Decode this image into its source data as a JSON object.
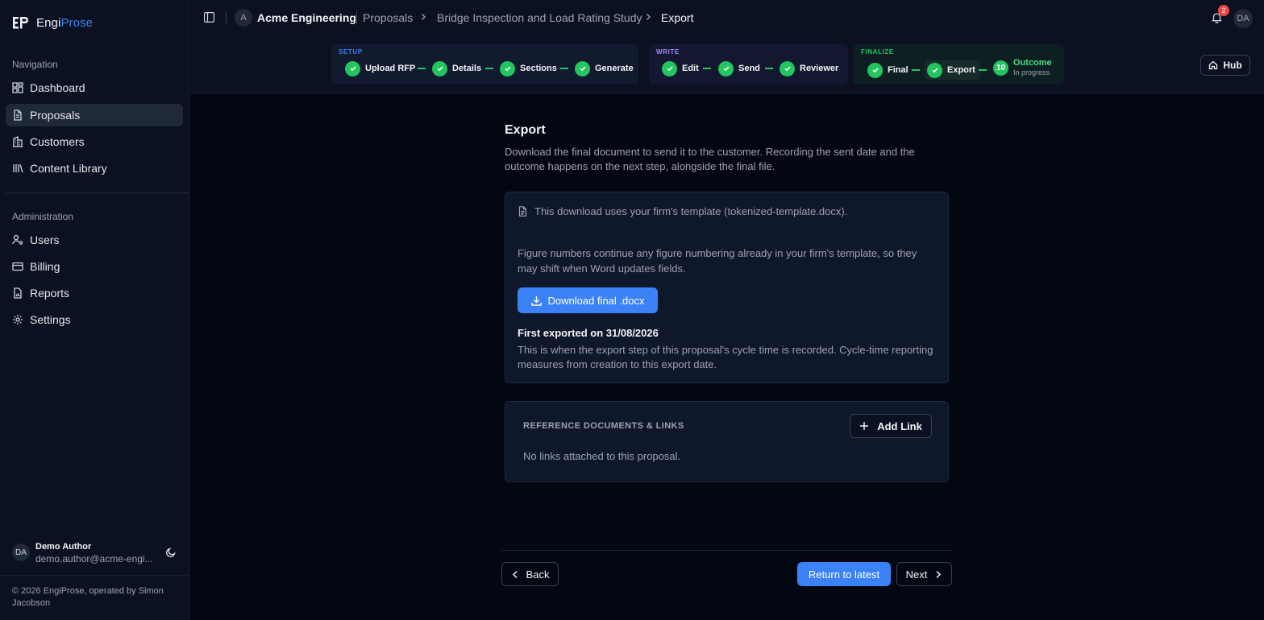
{
  "app": {
    "brand_prefix": "Engi",
    "brand_suffix": "Prose",
    "accent_color": "#3b82f6",
    "success_color": "#22c55e"
  },
  "sidebar": {
    "nav_label": "Navigation",
    "nav_items": [
      {
        "label": "Dashboard",
        "icon": "dashboard-icon",
        "active": false
      },
      {
        "label": "Proposals",
        "icon": "document-icon",
        "active": true
      },
      {
        "label": "Customers",
        "icon": "building-icon",
        "active": false
      },
      {
        "label": "Content Library",
        "icon": "library-icon",
        "active": false
      }
    ],
    "admin_label": "Administration",
    "admin_items": [
      {
        "label": "Users",
        "icon": "user-gear-icon"
      },
      {
        "label": "Billing",
        "icon": "credit-card-icon"
      },
      {
        "label": "Reports",
        "icon": "report-icon"
      },
      {
        "label": "Settings",
        "icon": "gear-icon"
      }
    ],
    "user": {
      "initials": "DA",
      "name": "Demo Author",
      "email": "demo.author@acme-engi..."
    },
    "copyright": "© 2026 EngiProse, operated by Simon Jacobson"
  },
  "topbar": {
    "org_initial": "A",
    "org_name": "Acme Engineering",
    "breadcrumbs": [
      "Proposals",
      "Bridge Inspection and Load Rating Study",
      "Export"
    ],
    "notification_count": "2",
    "user_initials": "DA"
  },
  "stepper": {
    "phases": [
      {
        "label": "SETUP",
        "steps": [
          "Upload RFP",
          "Details",
          "Sections",
          "Generate"
        ]
      },
      {
        "label": "WRITE",
        "steps": [
          "Edit",
          "Send",
          "Reviewer"
        ]
      },
      {
        "label": "FINALIZE",
        "steps": [
          "Final",
          "Export"
        ]
      }
    ],
    "outcome": {
      "number": "10",
      "label": "Outcome",
      "status": "In progress"
    },
    "hub_label": "Hub"
  },
  "main": {
    "title": "Export",
    "description": "Download the final document to send it to the customer. Recording the sent date and the outcome happens on the next step, alongside the final file.",
    "template_note": "This download uses your firm's template (tokenized-template.docx).",
    "figure_note": "Figure numbers continue any figure numbering already in your firm's template, so they may shift when Word updates fields.",
    "download_label": "Download final .docx",
    "first_exported": "First exported on 31/08/2026",
    "cycle_note": "This is when the export step of this proposal's cycle time is recorded. Cycle-time reporting measures from creation to this export date.",
    "links_title": "REFERENCE DOCUMENTS & LINKS",
    "add_link_label": "Add Link",
    "no_links": "No links attached to this proposal."
  },
  "footer_nav": {
    "back_label": "Back",
    "return_label": "Return to latest",
    "next_label": "Next"
  }
}
